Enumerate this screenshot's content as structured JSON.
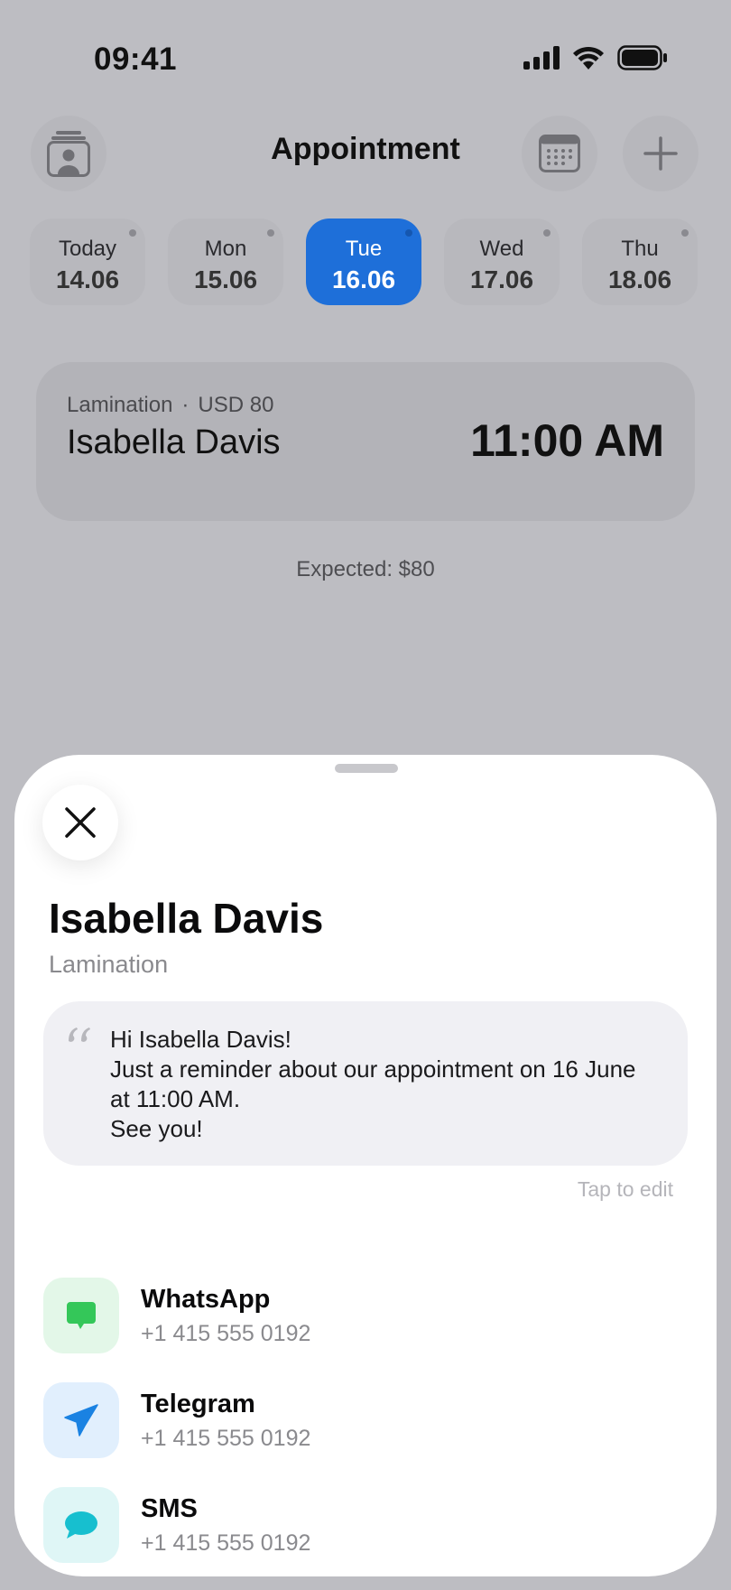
{
  "status_bar": {
    "time": "09:41"
  },
  "header": {
    "title": "Appointment"
  },
  "days": [
    {
      "name": "Today",
      "date": "14.06",
      "selected": false
    },
    {
      "name": "Mon",
      "date": "15.06",
      "selected": false
    },
    {
      "name": "Tue",
      "date": "16.06",
      "selected": true
    },
    {
      "name": "Wed",
      "date": "17.06",
      "selected": false
    },
    {
      "name": "Thu",
      "date": "18.06",
      "selected": false
    }
  ],
  "appointment": {
    "service": "Lamination",
    "separator": "·",
    "price": "USD 80",
    "client": "Isabella Davis",
    "time": "11:00 AM"
  },
  "expected": "Expected: $80",
  "sheet": {
    "name": "Isabella Davis",
    "service": "Lamination",
    "message": "Hi Isabella Davis!\nJust a reminder about our appointment on 16 June at 11:00 AM.\nSee you!",
    "tap_to_edit": "Tap to edit",
    "contacts": [
      {
        "label": "WhatsApp",
        "phone": "+1 415 555 0192",
        "icon": "whatsapp-icon",
        "bg": "#e3f7e8",
        "color": "#34c759"
      },
      {
        "label": "Telegram",
        "phone": "+1 415 555 0192",
        "icon": "telegram-icon",
        "bg": "#e1effd",
        "color": "#1a82e2"
      },
      {
        "label": "SMS",
        "phone": "+1 415 555 0192",
        "icon": "sms-icon",
        "bg": "#dff6f6",
        "color": "#17bfcf"
      }
    ]
  },
  "colors": {
    "accent": "#1e6fd9",
    "dimmed_background": "#bdbdc2"
  }
}
